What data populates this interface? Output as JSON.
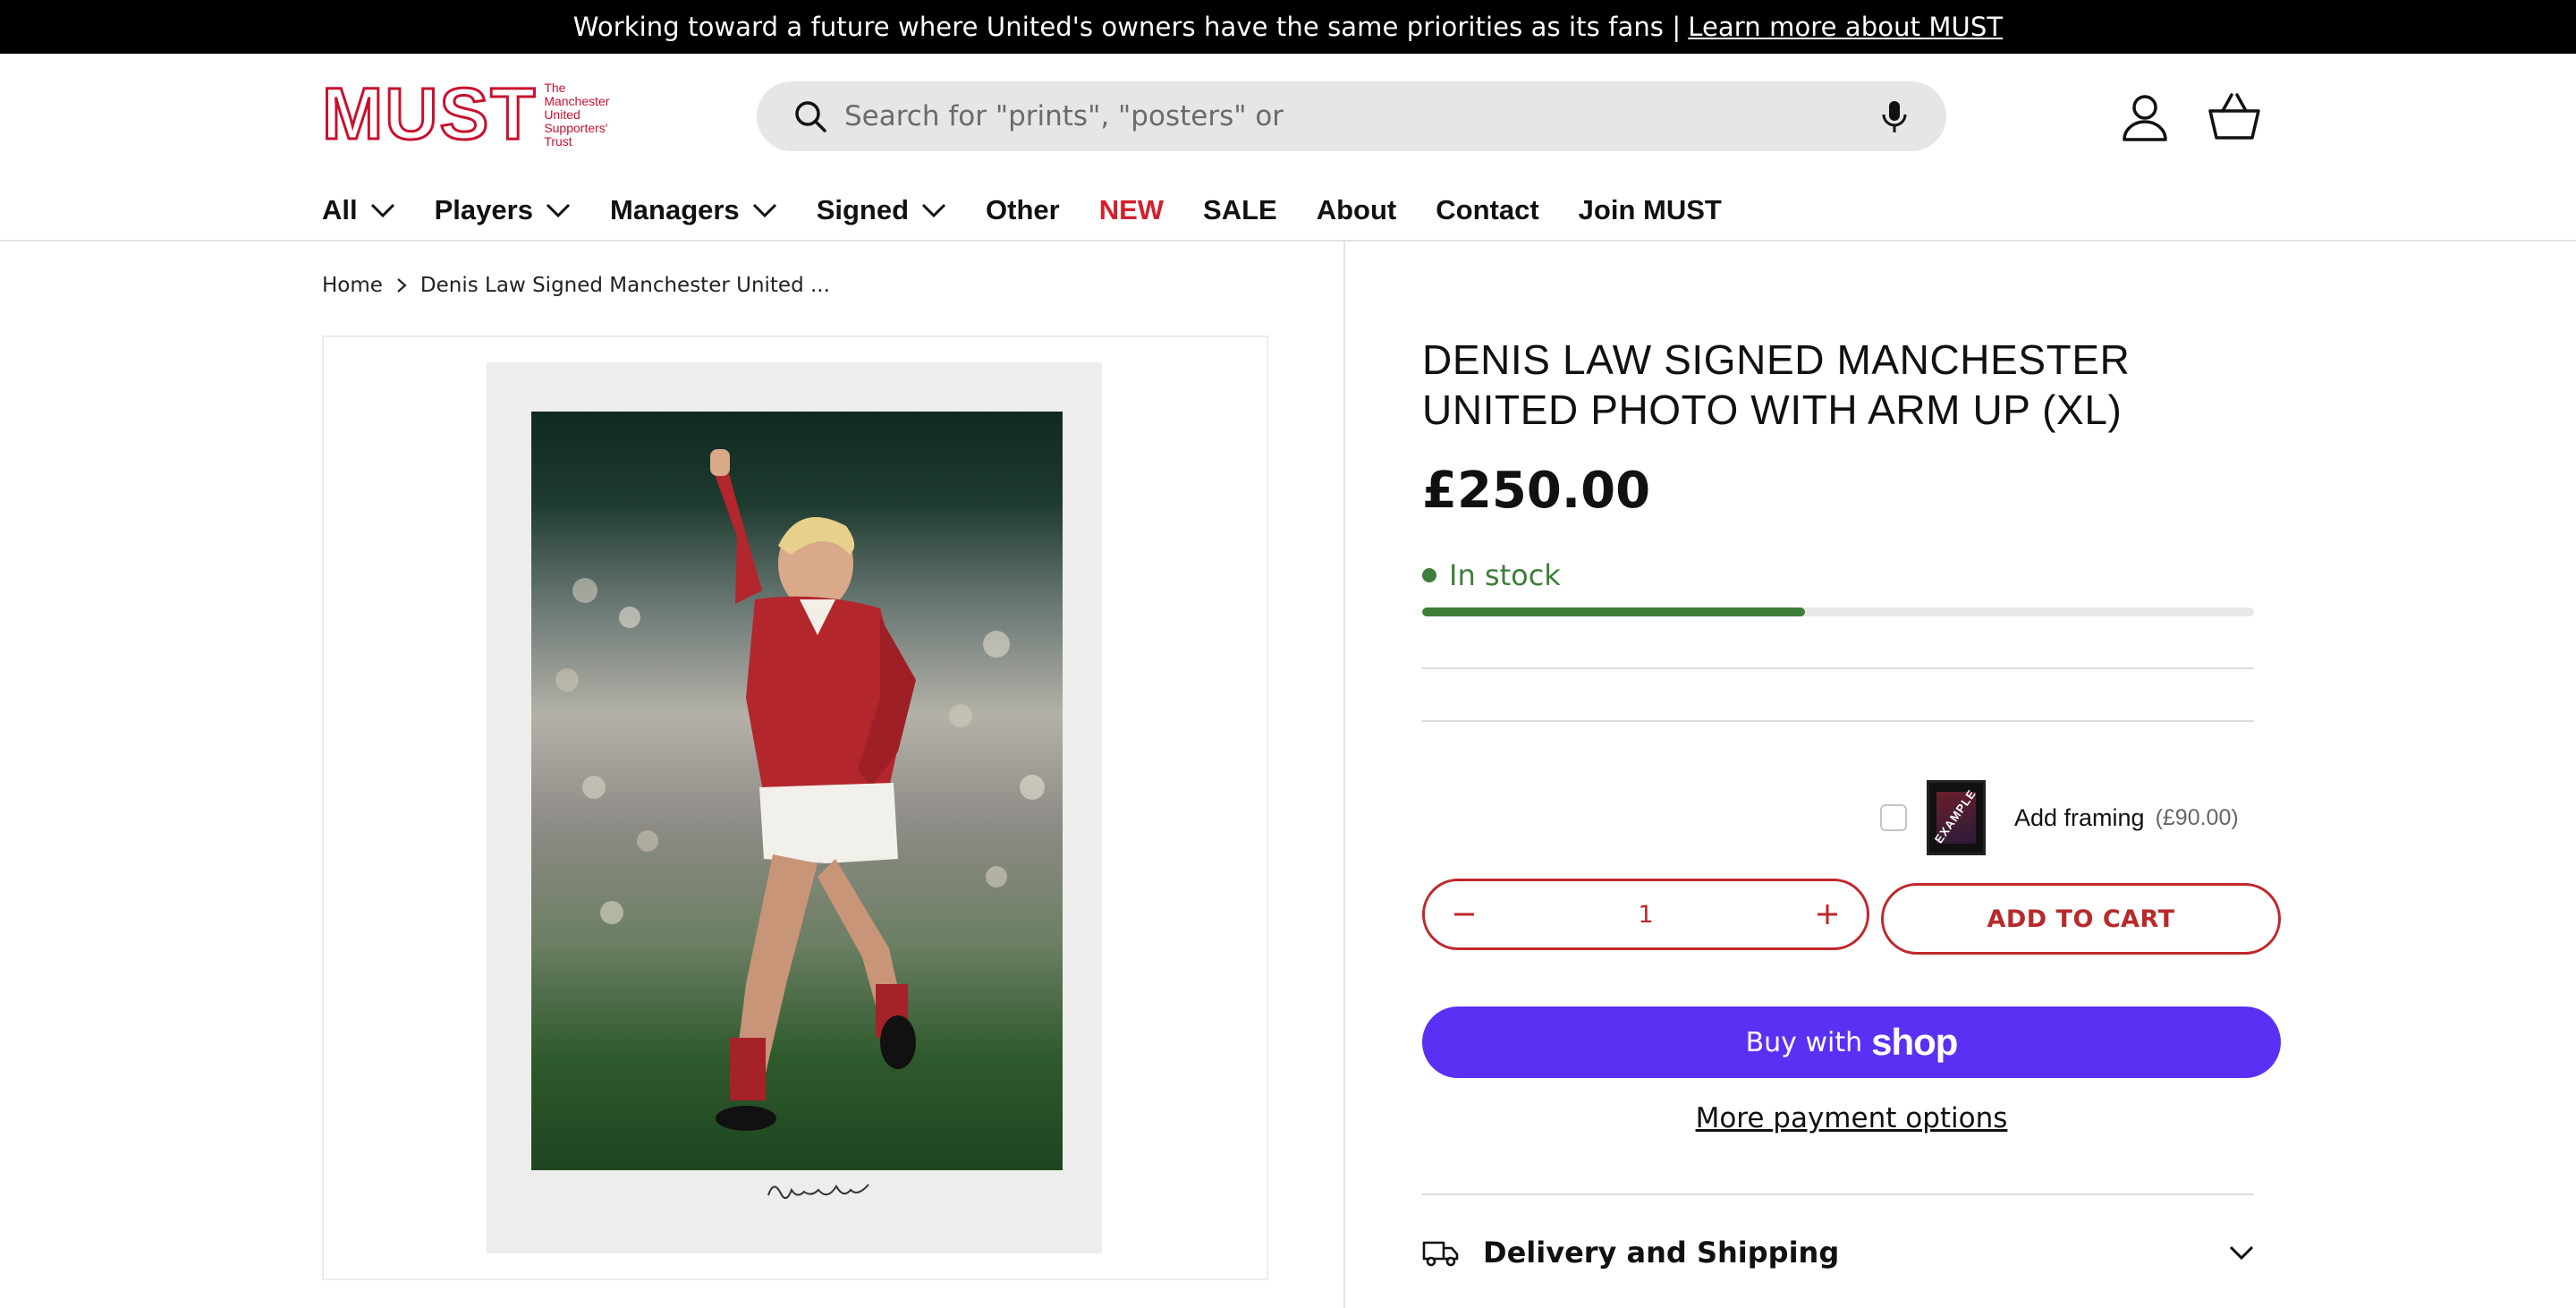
{
  "announcement": {
    "text": "Working toward a future where United's owners have the same priorities as its fans |",
    "link": "Learn more about MUST"
  },
  "header": {
    "logo": {
      "mark": "MUST",
      "line1": "The",
      "line2": "Manchester",
      "line3": "United",
      "line4": "Supporters'",
      "line5": "Trust"
    },
    "search_placeholder": "Search for \"prints\", \"posters\" or"
  },
  "nav": {
    "items": [
      {
        "label": "All",
        "dropdown": true
      },
      {
        "label": "Players",
        "dropdown": true
      },
      {
        "label": "Managers",
        "dropdown": true
      },
      {
        "label": "Signed",
        "dropdown": true
      },
      {
        "label": "Other",
        "dropdown": false
      },
      {
        "label": "NEW",
        "dropdown": false
      },
      {
        "label": "SALE",
        "dropdown": false
      },
      {
        "label": "About",
        "dropdown": false
      },
      {
        "label": "Contact",
        "dropdown": false
      },
      {
        "label": "Join MUST",
        "dropdown": false
      }
    ]
  },
  "breadcrumb": {
    "home": "Home",
    "current": "Denis Law Signed Manchester United ..."
  },
  "product": {
    "title": "DENIS LAW SIGNED MANCHESTER UNITED PHOTO WITH ARM UP (XL)",
    "price": "£250.00",
    "stock_text": "In stock",
    "stock_level": 0.46,
    "addon": {
      "label": "Add framing",
      "price": "(£90.00)",
      "thumb_text": "EXAMPLE"
    },
    "quantity": "1",
    "add_to_cart": "ADD TO CART",
    "buy_with": "Buy with",
    "buy_brand": "shop",
    "more_payment": "More payment options",
    "delivery_label": "Delivery and Shipping"
  },
  "colors": {
    "accent": "#c0282c",
    "stock": "#3f7d3a",
    "shop_pay": "#5a31f4",
    "new": "#d4202c"
  }
}
